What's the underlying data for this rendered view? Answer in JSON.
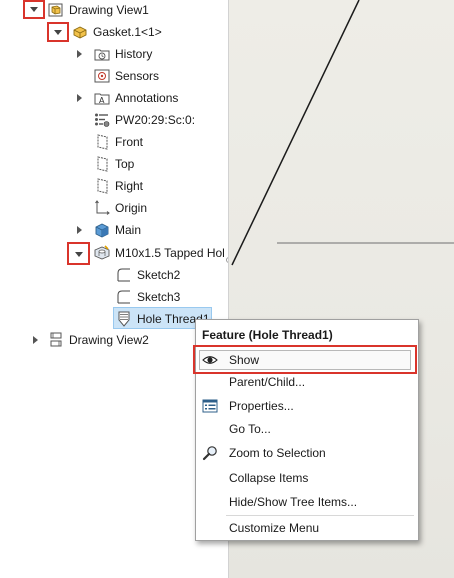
{
  "tree": {
    "drawing_view1": "Drawing View1",
    "gasket": "Gasket.1<1>",
    "history": "History",
    "sensors": "Sensors",
    "annotations": "Annotations",
    "material": "PW20:29:Sc:0:",
    "front": "Front",
    "top": "Top",
    "right": "Right",
    "origin": "Origin",
    "main": "Main",
    "tapped_hole": "M10x1.5 Tapped Hol",
    "sketch2": "Sketch2",
    "sketch3": "Sketch3",
    "hole_thread": "Hole Thread1",
    "drawing_view2": "Drawing View2"
  },
  "context_menu": {
    "title": "Feature (Hole Thread1)",
    "items": {
      "show": "Show",
      "parent_child": "Parent/Child...",
      "properties": "Properties...",
      "go_to": "Go To...",
      "zoom_to_selection": "Zoom to Selection",
      "collapse_items": "Collapse Items",
      "hide_show_tree": "Hide/Show Tree Items...",
      "customize_menu": "Customize Menu"
    }
  },
  "colors": {
    "highlight_red": "#d9342b",
    "selection_blue": "#cce4f7",
    "viewport_bg": "#eceae4"
  }
}
